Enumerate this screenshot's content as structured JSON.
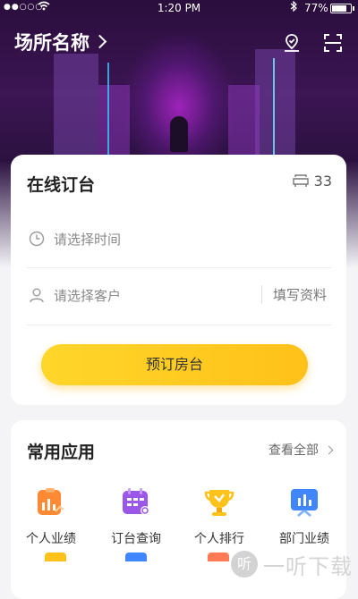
{
  "status_bar": {
    "signal": "●●○○○",
    "time": "1:20 PM",
    "battery": "77%"
  },
  "header": {
    "venue_name": "场所名称"
  },
  "booking_card": {
    "title": "在线订台",
    "seat_count": "33",
    "time_placeholder": "请选择时间",
    "customer_placeholder": "请选择客户",
    "fill_info_label": "填写资料",
    "book_button_label": "预订房台"
  },
  "apps_card": {
    "title": "常用应用",
    "view_all_label": "查看全部",
    "items": [
      {
        "label": "个人业绩",
        "icon": "personal-performance-icon",
        "color": "#ff8a33"
      },
      {
        "label": "订台查询",
        "icon": "booking-query-icon",
        "color": "#9b57e8"
      },
      {
        "label": "个人排行",
        "icon": "ranking-trophy-icon",
        "color": "#ffc21a"
      },
      {
        "label": "部门业绩",
        "icon": "department-performance-icon",
        "color": "#3f86ff"
      }
    ]
  },
  "watermark": {
    "text": "一听下载",
    "logo_glyph": "听"
  },
  "colors": {
    "accent": "#ffc61f",
    "card_bg": "#ffffff",
    "page_bg": "#f4f4f7"
  }
}
